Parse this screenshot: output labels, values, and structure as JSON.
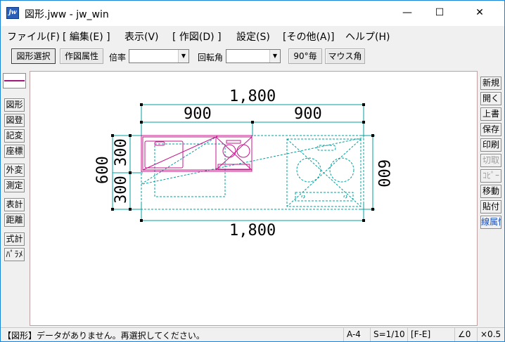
{
  "window": {
    "title": "図形.jww - jw_win",
    "app_icon": "jw",
    "minimize": "—",
    "maximize": "☐",
    "close": "✕"
  },
  "menu": [
    "ファイル(F)",
    "[ 編集(E) ]",
    "表示(V)",
    "[ 作図(D) ]",
    "設定(S)",
    "[その他(A)]",
    "ヘルプ(H)"
  ],
  "toolbar": {
    "select_figure": "図形選択",
    "drawing_attributes": "作図属性",
    "scale_label": "倍率",
    "scale_value": "",
    "rotation_label": "回転角",
    "rotation_value": "",
    "deg90": "90°毎",
    "mouse_angle": "マウス角"
  },
  "left_panel": [
    "図形",
    "図登",
    "記変",
    "座標",
    "外変",
    "測定",
    "表計",
    "距離",
    "式計",
    "ﾊﾟﾗﾒ"
  ],
  "right_panel": [
    "新規",
    "開く",
    "上書",
    "保存",
    "印刷",
    "切取",
    "ｺﾋﾟｰ",
    "移動",
    "貼付",
    "線属性"
  ],
  "drawing": {
    "dim_top_total": "1,800",
    "dim_top_left": "900",
    "dim_top_right": "900",
    "dim_bottom_total": "1,800",
    "dim_left_total": "600",
    "dim_left_top": "300",
    "dim_left_bottom": "300",
    "dim_right_total": "600",
    "colors": {
      "dimension": "#00a0a0",
      "figure": "#c8148c",
      "counter": "#00a0a0"
    }
  },
  "status": {
    "message": "【図形】データがありません。再選択してください。",
    "paper": "A-4",
    "scale": "S=1/10",
    "layer": "[F-E]",
    "angle": "∠0",
    "zoom": "×0.5"
  }
}
